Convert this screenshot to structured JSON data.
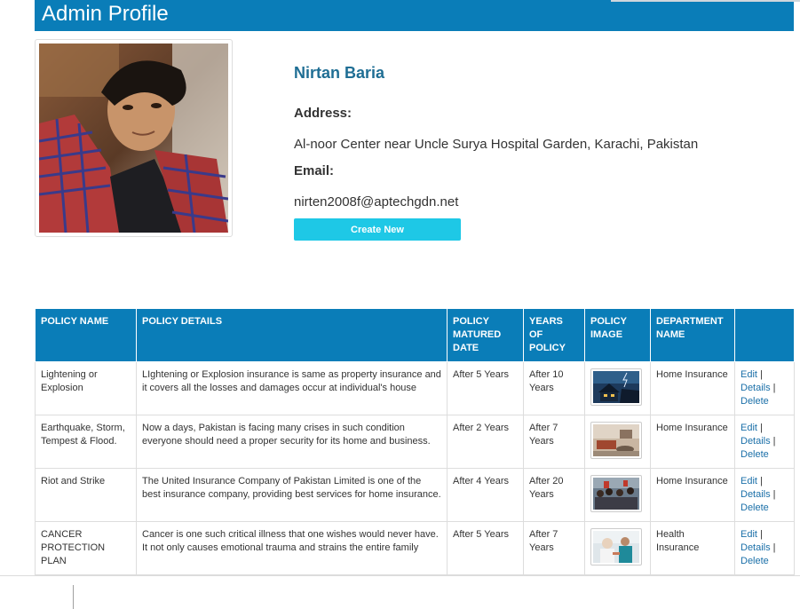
{
  "header": {
    "title": "Admin Profile"
  },
  "profile": {
    "name": "Nirtan Baria",
    "address_label": "Address:",
    "address": "Al-noor Center near Uncle Surya Hospital Garden, Karachi, Pakistan",
    "email_label": "Email:",
    "email": "nirten2008f@aptechgdn.net",
    "create_button": "Create New"
  },
  "table": {
    "headers": [
      "POLICY NAME",
      "POLICY DETAILS",
      "POLICY MATURED DATE",
      "YEARS OF POLICY",
      "POLICY IMAGE",
      "DEPARTMENT NAME",
      ""
    ],
    "rows": [
      {
        "name": "Lightening or Explosion",
        "details": "LIghtening or Explosion insurance is same as property insurance and it covers all the losses and damages occur at individual's house",
        "matured": "After 5 Years",
        "years": "After 10 Years",
        "department": "Home Insurance",
        "edit": "Edit",
        "details_link": "Details",
        "delete": "Delete"
      },
      {
        "name": "Earthquake, Storm, Tempest & Flood.",
        "details": "Now a days, Pakistan is facing many crises in such condition everyone should need a proper security for its home and business.",
        "matured": "After 2 Years",
        "years": "After 7 Years",
        "department": "Home Insurance",
        "edit": "Edit",
        "details_link": "Details",
        "delete": "Delete"
      },
      {
        "name": "Riot and Strike",
        "details": "The United Insurance Company of Pakistan Limited is one of the best insurance company, providing best services for home insurance.",
        "matured": "After 4 Years",
        "years": "After 20 Years",
        "department": "Home Insurance",
        "edit": "Edit",
        "details_link": "Details",
        "delete": "Delete"
      },
      {
        "name": "CANCER PROTECTION PLAN",
        "details": "Cancer is one such critical illness that one wishes would never have. It not only causes emotional trauma and strains the entire family",
        "matured": "After 5 Years",
        "years": "After 7 Years",
        "department": "Health Insurance",
        "edit": "Edit",
        "details_link": "Details",
        "delete": "Delete"
      }
    ]
  },
  "colors": {
    "header_bg": "#0a7db8",
    "button_bg": "#1ec8e6",
    "name_color": "#1f6e94",
    "link_color": "#1a6fa8"
  }
}
